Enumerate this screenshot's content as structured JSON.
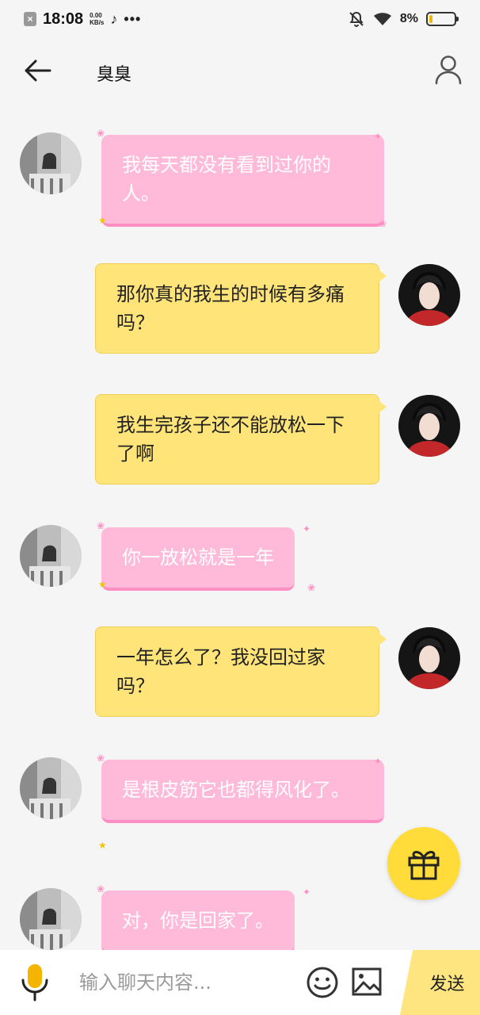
{
  "status_bar": {
    "time": "18:08",
    "net_speed_value": "0.00",
    "net_speed_unit": "KB/s",
    "dots": "•••",
    "battery_text": "8%",
    "battery_level_percent": 8
  },
  "header": {
    "title": "臭臭",
    "icons": {
      "back": "back-arrow-icon",
      "profile": "user-profile-icon"
    }
  },
  "messages": [
    {
      "side": "left",
      "style": "pink",
      "text": "我每天都没有看到过你的人。"
    },
    {
      "side": "right",
      "style": "yellow",
      "text": "那你真的我生的时候有多痛吗？"
    },
    {
      "side": "right",
      "style": "yellow",
      "text": "我生完孩子还不能放松一下了啊"
    },
    {
      "side": "left",
      "style": "pink",
      "text": "你一放松就是一年"
    },
    {
      "side": "right",
      "style": "yellow",
      "text": "一年怎么了？我没回过家吗？"
    },
    {
      "side": "left",
      "style": "pink",
      "text": "是根皮筋它也都得风化了。"
    },
    {
      "side": "left",
      "style": "pink",
      "text": "对，你是回家了。"
    }
  ],
  "gift_button": {
    "icon": "gift-icon",
    "color": "#ffdc3a"
  },
  "input_bar": {
    "placeholder": "输入聊天内容...",
    "send_label": "发送",
    "icons": {
      "mic": "microphone-icon",
      "emoji": "emoji-icon",
      "image": "image-icon"
    }
  },
  "colors": {
    "background": "#f5f5f5",
    "pink_bubble": "#ffb9d9",
    "yellow_bubble": "#ffe47a",
    "accent_yellow": "#ffdc3a"
  }
}
